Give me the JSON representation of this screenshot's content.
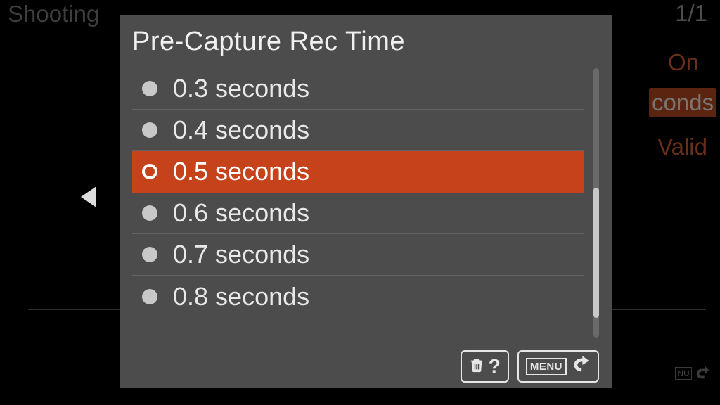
{
  "background": {
    "menu_name": "Shooting",
    "page_indicator": "1/1",
    "value_on": "On",
    "value_conds": "conds",
    "value_valid": "Valid",
    "menu_small": "NU"
  },
  "dialog": {
    "title": "Pre-Capture Rec Time",
    "selected_index": 2,
    "options": [
      {
        "label": "0.3 seconds"
      },
      {
        "label": "0.4 seconds"
      },
      {
        "label": "0.5 seconds"
      },
      {
        "label": "0.6 seconds"
      },
      {
        "label": "0.7 seconds"
      },
      {
        "label": "0.8 seconds"
      }
    ],
    "footer": {
      "help_symbol": "?",
      "menu_label": "MENU"
    }
  }
}
